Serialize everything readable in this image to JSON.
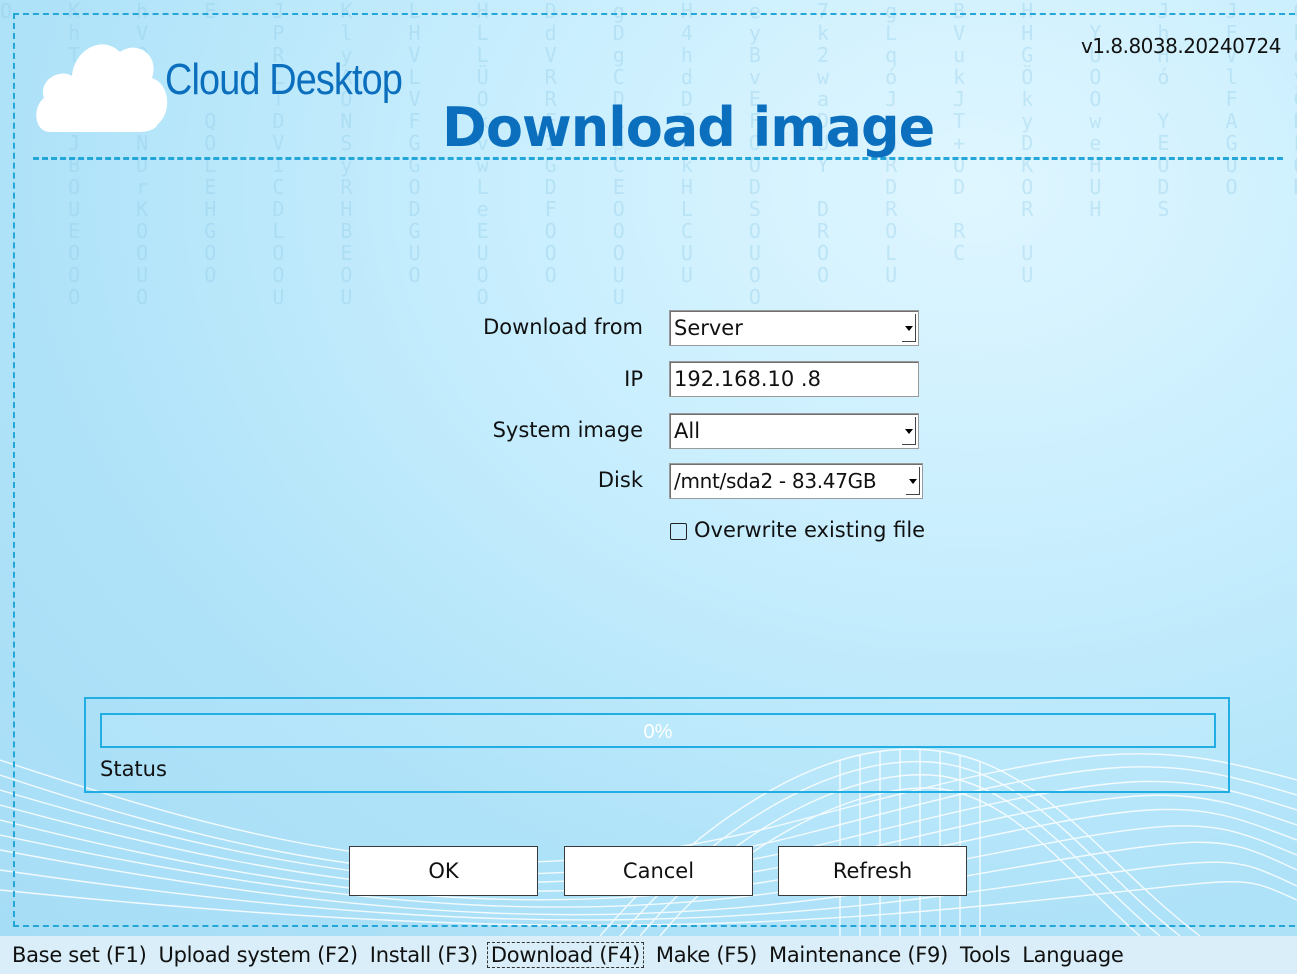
{
  "header": {
    "brand": "Cloud Desktop",
    "title": "Download image",
    "version": "v1.8.8038.20240724"
  },
  "form": {
    "download_from": {
      "label": "Download from",
      "value": "Server"
    },
    "ip": {
      "label": "IP",
      "value": "192.168.10 .8"
    },
    "system_image": {
      "label": "System image",
      "value": "All"
    },
    "disk": {
      "label": "Disk",
      "value": "/mnt/sda2 - 83.47GB"
    },
    "overwrite": {
      "label": "Overwrite existing file",
      "checked": false
    }
  },
  "progress": {
    "percent_label": "0%",
    "value": 0,
    "status_label": "Status"
  },
  "buttons": {
    "ok": "OK",
    "cancel": "Cancel",
    "refresh": "Refresh"
  },
  "taskbar": [
    {
      "label": "Base set (F1)",
      "active": false
    },
    {
      "label": "Upload system (F2)",
      "active": false
    },
    {
      "label": "Install (F3)",
      "active": false
    },
    {
      "label": "Download (F4)",
      "active": true
    },
    {
      "label": "Make (F5)",
      "active": false
    },
    {
      "label": "Maintenance (F9)",
      "active": false
    },
    {
      "label": "Tools",
      "active": false
    },
    {
      "label": "Language",
      "active": false
    }
  ],
  "colors": {
    "accent": "#24a6d9",
    "title": "#0b6fbe",
    "background": "#bfe9fb"
  }
}
